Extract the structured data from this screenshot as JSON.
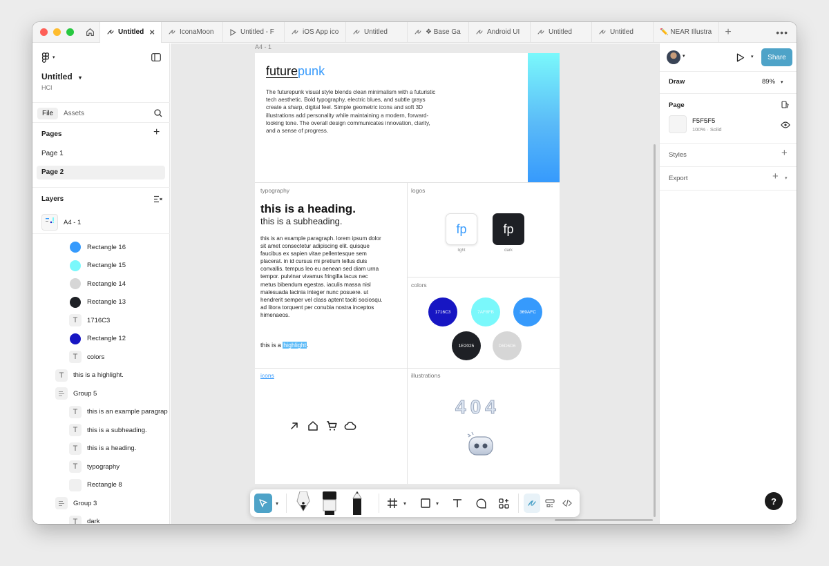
{
  "colors": {
    "accent": "#4EA3C8",
    "blue": "#369AFC",
    "navy": "#1716C3",
    "cyan": "#7AF8FB",
    "dark": "#1E2025",
    "gray": "#D6D6D6"
  },
  "tabs": [
    {
      "label": "Untitled",
      "icon": "figma-drawing-icon",
      "active": true
    },
    {
      "label": "IconaMoon",
      "icon": "figma-file-icon"
    },
    {
      "label": "Untitled - F",
      "icon": "prototype-play-icon"
    },
    {
      "label": "iOS App ico",
      "icon": "figma-file-icon"
    },
    {
      "label": "Untitled",
      "icon": "figma-file-icon"
    },
    {
      "label": "❖ Base Ga",
      "icon": "figma-file-icon"
    },
    {
      "label": "Android UI",
      "icon": "figma-file-icon"
    },
    {
      "label": "Untitled",
      "icon": "figma-file-icon"
    },
    {
      "label": "Untitled",
      "icon": "figma-file-icon"
    },
    {
      "label": "✏️ NEAR Illustra",
      "icon": "pencil-emoji-icon"
    }
  ],
  "left": {
    "file_title": "Untitled",
    "team": "HCI",
    "tab_file": "File",
    "tab_assets": "Assets",
    "pages_heading": "Pages",
    "pages": [
      "Page 1",
      "Page 2"
    ],
    "layers_heading": "Layers",
    "frame_layer": "A4 - 1",
    "layers": [
      {
        "name": "Rectangle 16",
        "kind": "dot",
        "color": "#369AFC",
        "indent": 2
      },
      {
        "name": "Rectangle 15",
        "kind": "dot",
        "color": "#7AF8FB",
        "indent": 2
      },
      {
        "name": "Rectangle 14",
        "kind": "dot",
        "color": "#D6D6D6",
        "indent": 2
      },
      {
        "name": "Rectangle 13",
        "kind": "dot",
        "color": "#1E2025",
        "indent": 2
      },
      {
        "name": "1716C3",
        "kind": "text",
        "indent": 2
      },
      {
        "name": "Rectangle 12",
        "kind": "dot",
        "color": "#1716C3",
        "indent": 2
      },
      {
        "name": "colors",
        "kind": "text",
        "indent": 2
      },
      {
        "name": "this is a highlight.",
        "kind": "text",
        "indent": 1
      },
      {
        "name": "Group 5",
        "kind": "group",
        "indent": 1
      },
      {
        "name": "this is an example paragrap",
        "kind": "text",
        "indent": 2
      },
      {
        "name": "this is a subheading.",
        "kind": "text",
        "indent": 2
      },
      {
        "name": "this is a heading.",
        "kind": "text",
        "indent": 2
      },
      {
        "name": "typography",
        "kind": "text",
        "indent": 2
      },
      {
        "name": "Rectangle 8",
        "kind": "rect",
        "indent": 2
      },
      {
        "name": "Group 3",
        "kind": "group",
        "indent": 1
      },
      {
        "name": "dark",
        "kind": "text",
        "indent": 2
      }
    ]
  },
  "canvas": {
    "frame_label": "A4 - 1",
    "brand_a": "future",
    "brand_b": "punk",
    "intro": "The futurepunk visual style blends clean minimalism with a futuristic tech aesthetic. Bold typography, electric blues, and subtle grays create a sharp, digital feel. Simple geometric icons and soft 3D illustrations add personality while maintaining a modern, forward-looking tone. The overall design communicates innovation, clarity, and a sense of progress.",
    "typography_label": "typography",
    "heading": "this is a heading.",
    "subheading": "this is a subheading.",
    "paragraph": "this is an example paragraph. lorem ipsum dolor sit amet consectetur adipiscing elit. quisque faucibus ex sapien vitae pellentesque sem placerat. in id cursus mi pretium tellus duis convallis. tempus leo eu aenean sed diam urna tempor. pulvinar vivamus fringilla lacus nec metus bibendum egestas. iaculis massa nisl malesuada lacinia integer nunc posuere. ut hendrerit semper vel class aptent taciti sociosqu. ad litora torquent per conubia nostra inceptos himenaeos.",
    "highlight_prefix": "this is a ",
    "highlight_word": "highlight",
    "highlight_suffix": ".",
    "logos_label": "logos",
    "logo_text": "fp",
    "logo_light_caption": "light",
    "logo_dark_caption": "dark",
    "colors_label": "colors",
    "swatches": [
      {
        "hex": "1716C3",
        "color": "#1716C3"
      },
      {
        "hex": "7AF8FB",
        "color": "#7AF8FB"
      },
      {
        "hex": "369AFC",
        "color": "#369AFC"
      },
      {
        "hex": "1E2025",
        "color": "#1E2025"
      },
      {
        "hex": "D6D6D6",
        "color": "#D6D6D6"
      }
    ],
    "icons_label": "icons",
    "icons": [
      "arrow-up-right-icon",
      "home-icon",
      "cart-icon",
      "cloud-icon"
    ],
    "illustrations_label": "illustrations",
    "illustration_404": "404"
  },
  "right": {
    "share": "Share",
    "draw": "Draw",
    "zoom": "89%",
    "page_heading": "Page",
    "page_color": "F5F5F5",
    "page_color_detail": "100% · Solid",
    "styles": "Styles",
    "export": "Export",
    "help": "?"
  }
}
